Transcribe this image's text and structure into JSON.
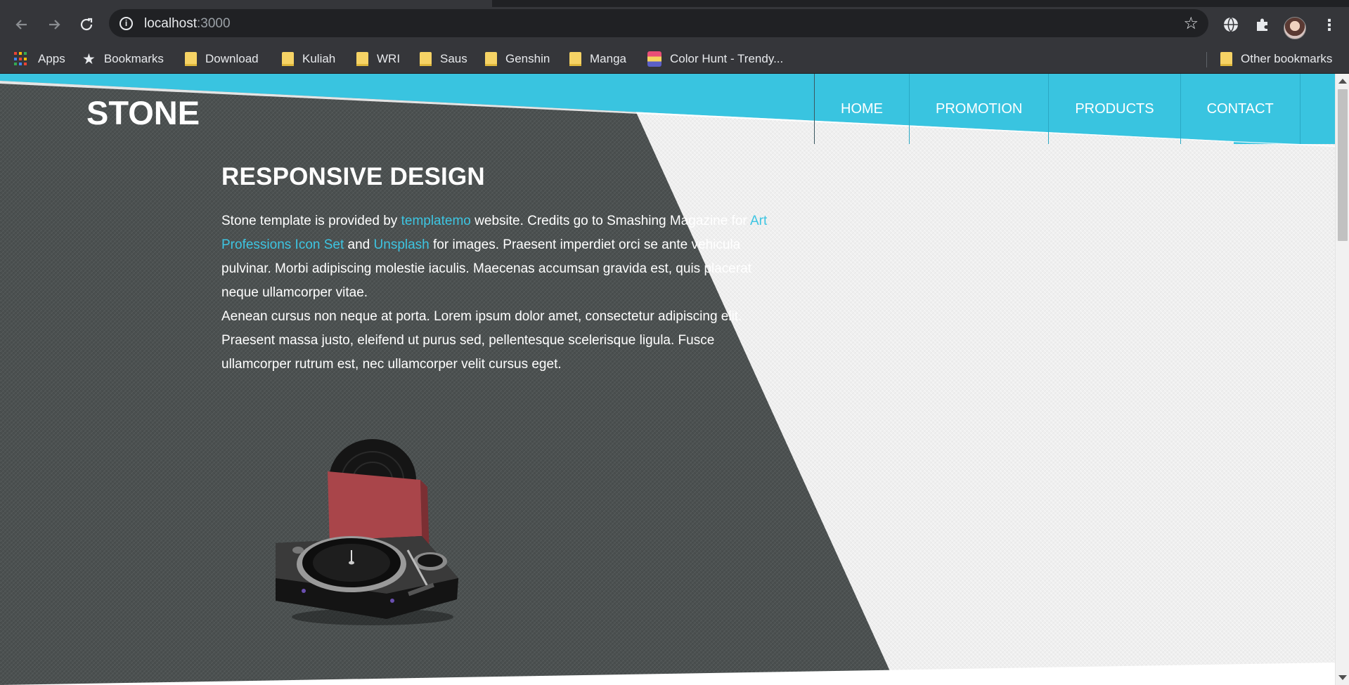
{
  "browser": {
    "url_host": "localhost",
    "url_port": ":3000",
    "bookmarks": [
      {
        "label": "Apps",
        "icon": "apps-grid-icon"
      },
      {
        "label": "Bookmarks",
        "icon": "star-icon"
      },
      {
        "label": "Download",
        "icon": "folder-icon"
      },
      {
        "label": "Kuliah",
        "icon": "folder-icon"
      },
      {
        "label": "WRI",
        "icon": "folder-icon"
      },
      {
        "label": "Saus",
        "icon": "folder-icon"
      },
      {
        "label": "Genshin",
        "icon": "folder-icon"
      },
      {
        "label": "Manga",
        "icon": "folder-icon"
      },
      {
        "label": "Color Hunt - Trendy...",
        "icon": "color-hunt-icon"
      }
    ],
    "other_bookmarks": "Other bookmarks"
  },
  "site": {
    "logo": "STONE",
    "nav": [
      "HOME",
      "PROMOTION",
      "PRODUCTS",
      "CONTACT"
    ],
    "heading": "RESPONSIVE DESIGN",
    "para1": {
      "t1": "Stone template is provided by ",
      "link1": "templatemo",
      "t2": " website. Credits go to Smashing Magazine for ",
      "link2": "Art Professions Icon Set",
      "t3": " and ",
      "link3": "Unsplash",
      "t4": " for images. Praesent imperdiet orci se ante vehicula pulvinar. Morbi adipiscing molestie iaculis. Maecenas accumsan gravida est, quis placerat neque ullamcorper vitae."
    },
    "para2": "Aenean cursus non neque at porta. Lorem ipsum dolor amet, consectetur adipiscing elit. Praesent massa justo, eleifend ut purus sed, pellentesque scelerisque ligula. Fusce ullamcorper rutrum est, nec ullamcorper velit cursus eget."
  },
  "colors": {
    "accent": "#39c4e0",
    "dark_bg": "#4b5050",
    "light_bg": "#efefef",
    "link": "#3dc5e2"
  }
}
